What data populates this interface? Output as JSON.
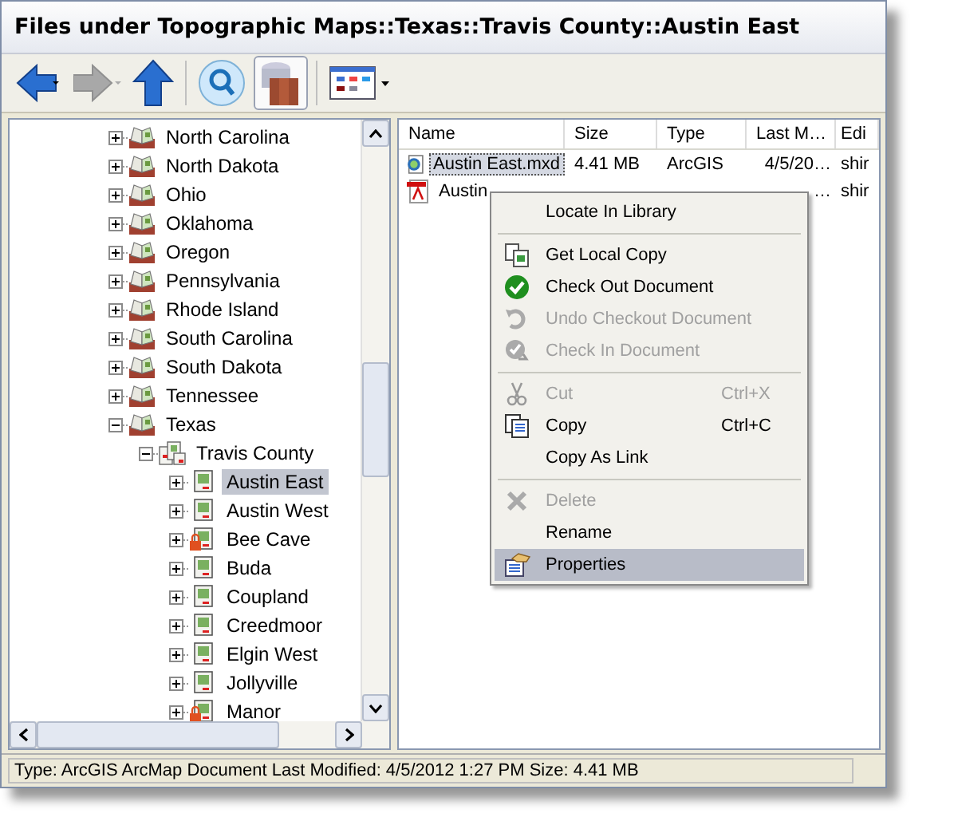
{
  "window": {
    "title": "Files under Topographic Maps::Texas::Travis County::Austin East"
  },
  "toolbar": {
    "forward_disabled": true,
    "library_active": true
  },
  "tree": {
    "items": [
      {
        "label": "North Carolina",
        "kind": "state",
        "expanded": false
      },
      {
        "label": "North Dakota",
        "kind": "state",
        "expanded": false
      },
      {
        "label": "Ohio",
        "kind": "state",
        "expanded": false
      },
      {
        "label": "Oklahoma",
        "kind": "state",
        "expanded": false
      },
      {
        "label": "Oregon",
        "kind": "state",
        "expanded": false
      },
      {
        "label": "Pennsylvania",
        "kind": "state",
        "expanded": false
      },
      {
        "label": "Rhode Island",
        "kind": "state",
        "expanded": false
      },
      {
        "label": "South Carolina",
        "kind": "state",
        "expanded": false
      },
      {
        "label": "South Dakota",
        "kind": "state",
        "expanded": false
      },
      {
        "label": "Tennessee",
        "kind": "state",
        "expanded": false
      },
      {
        "label": "Texas",
        "kind": "state",
        "expanded": true,
        "children": [
          {
            "label": "Travis County",
            "kind": "county",
            "expanded": true,
            "children": [
              {
                "label": "Austin East",
                "kind": "map",
                "expanded": false,
                "selected": true,
                "locked": false
              },
              {
                "label": "Austin West",
                "kind": "map",
                "expanded": false,
                "selected": false,
                "locked": false
              },
              {
                "label": "Bee Cave",
                "kind": "map",
                "expanded": false,
                "selected": false,
                "locked": true
              },
              {
                "label": "Buda",
                "kind": "map",
                "expanded": false,
                "selected": false,
                "locked": false
              },
              {
                "label": "Coupland",
                "kind": "map",
                "expanded": false,
                "selected": false,
                "locked": false
              },
              {
                "label": "Creedmoor",
                "kind": "map",
                "expanded": false,
                "selected": false,
                "locked": false
              },
              {
                "label": "Elgin West",
                "kind": "map",
                "expanded": false,
                "selected": false,
                "locked": false
              },
              {
                "label": "Jollyville",
                "kind": "map",
                "expanded": false,
                "selected": false,
                "locked": false
              },
              {
                "label": "Manor",
                "kind": "map",
                "expanded": false,
                "selected": false,
                "locked": true
              }
            ]
          }
        ]
      }
    ]
  },
  "files": {
    "columns": [
      "Name",
      "Size",
      "Type",
      "Last M…",
      "Edi"
    ],
    "rows": [
      {
        "kind": "mxd",
        "selected": true,
        "cells": [
          "Austin East.mxd",
          "4.41 MB",
          "ArcGIS",
          "4/5/20…",
          "shir"
        ]
      },
      {
        "kind": "pdf",
        "selected": false,
        "cells": [
          "Austin",
          "",
          "",
          "…",
          "shir"
        ]
      }
    ]
  },
  "context_menu": {
    "items": [
      {
        "kind": "item",
        "label": "Locate In Library",
        "disabled": false,
        "selected": false
      },
      {
        "kind": "separator"
      },
      {
        "kind": "item",
        "label": "Get Local Copy",
        "disabled": false,
        "selected": false
      },
      {
        "kind": "item",
        "label": "Check Out Document",
        "disabled": false,
        "selected": false
      },
      {
        "kind": "item",
        "label": "Undo Checkout Document",
        "disabled": true,
        "selected": false
      },
      {
        "kind": "item",
        "label": "Check In Document",
        "disabled": true,
        "selected": false
      },
      {
        "kind": "separator"
      },
      {
        "kind": "item",
        "label": "Cut",
        "shortcut": "Ctrl+X",
        "disabled": true,
        "selected": false
      },
      {
        "kind": "item",
        "label": "Copy",
        "shortcut": "Ctrl+C",
        "disabled": false,
        "selected": false
      },
      {
        "kind": "item",
        "label": "Copy As Link",
        "disabled": false,
        "selected": false
      },
      {
        "kind": "separator"
      },
      {
        "kind": "item",
        "label": "Delete",
        "disabled": true,
        "selected": false
      },
      {
        "kind": "item",
        "label": "Rename",
        "disabled": false,
        "selected": false
      },
      {
        "kind": "item",
        "label": "Properties",
        "disabled": false,
        "selected": true
      }
    ]
  },
  "status_bar": {
    "text": "Type: ArcGIS ArcMap Document Last Modified: 4/5/2012 1:27 PM Size: 4.41 MB"
  }
}
